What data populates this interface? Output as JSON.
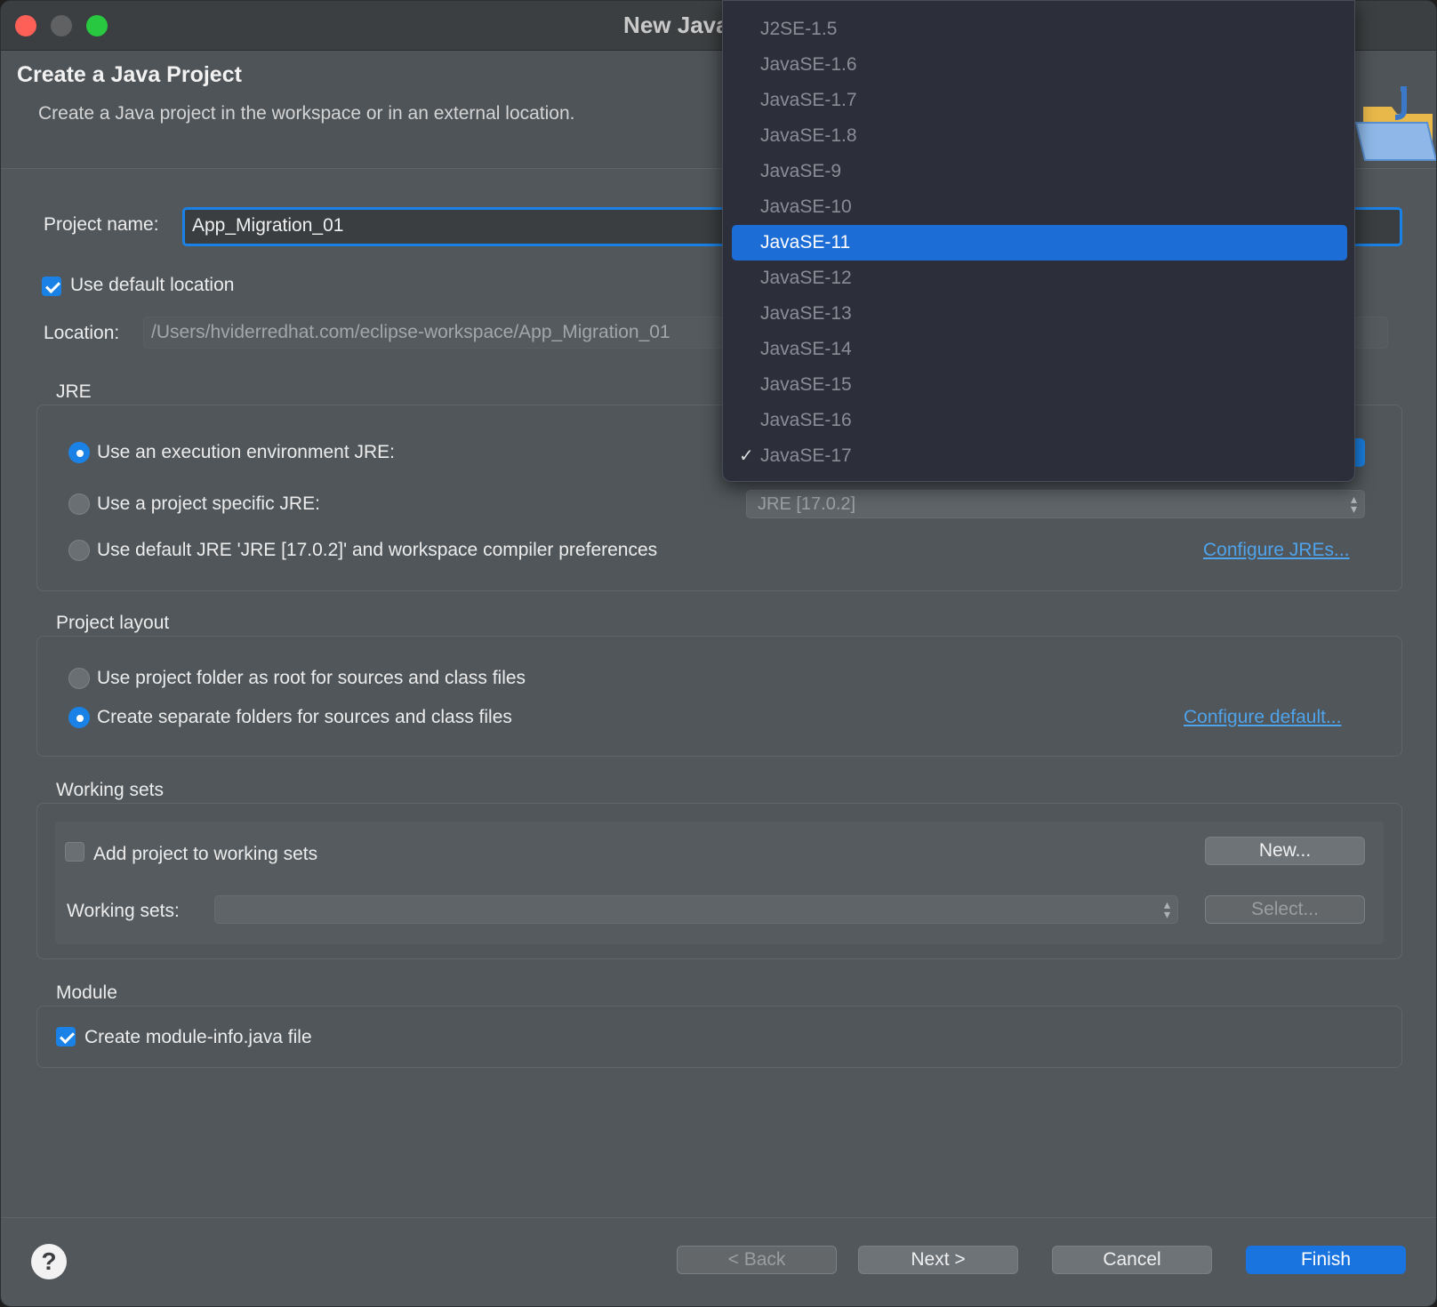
{
  "window": {
    "title": "New Java Project"
  },
  "header": {
    "title": "Create a Java Project",
    "description": "Create a Java project in the workspace or in an external location."
  },
  "project": {
    "name_label": "Project name:",
    "name_value": "App_Migration_01",
    "use_default_location_label": "Use default location",
    "use_default_location_checked": true,
    "location_label": "Location:",
    "location_value": "/Users/hviderredhat.com/eclipse-workspace/App_Migration_01"
  },
  "jre": {
    "title": "JRE",
    "option_env_label": "Use an execution environment JRE:",
    "option_specific_label": "Use a project specific JRE:",
    "option_specific_value": "JRE [17.0.2]",
    "option_default_label": "Use default JRE 'JRE [17.0.2]' and workspace compiler preferences",
    "configure_link": "Configure JREs..."
  },
  "layout": {
    "title": "Project layout",
    "option_root_label": "Use project folder as root for sources and class files",
    "option_separate_label": "Create separate folders for sources and class files",
    "configure_link": "Configure default..."
  },
  "working_sets": {
    "title": "Working sets",
    "add_label": "Add project to working sets",
    "add_checked": false,
    "new_button": "New...",
    "sets_label": "Working sets:",
    "sets_value": "",
    "select_button": "Select..."
  },
  "module": {
    "title": "Module",
    "create_label": "Create module-info.java file",
    "create_checked": true
  },
  "footer": {
    "help_icon": "?",
    "back_button": "< Back",
    "next_button": "Next >",
    "cancel_button": "Cancel",
    "finish_button": "Finish"
  },
  "dropdown": {
    "items": [
      "J2SE-1.5",
      "JavaSE-1.6",
      "JavaSE-1.7",
      "JavaSE-1.8",
      "JavaSE-9",
      "JavaSE-10",
      "JavaSE-11",
      "JavaSE-12",
      "JavaSE-13",
      "JavaSE-14",
      "JavaSE-15",
      "JavaSE-16",
      "JavaSE-17"
    ],
    "highlighted": "JavaSE-11",
    "checked": "JavaSE-17",
    "check_mark": "✓"
  },
  "colors": {
    "accent": "#1a82e6",
    "link": "#4fa3ea",
    "window_bg": "#51575b"
  }
}
